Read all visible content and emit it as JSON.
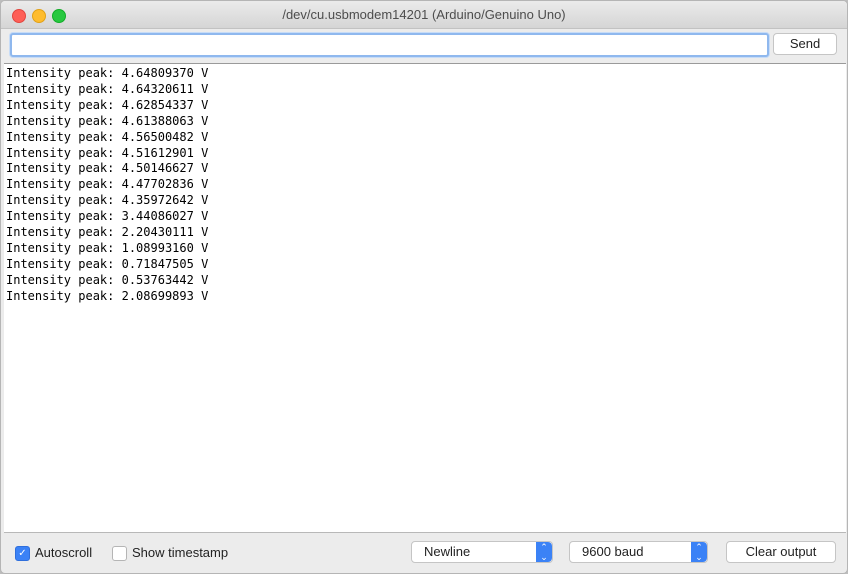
{
  "window": {
    "title": "/dev/cu.usbmodem14201 (Arduino/Genuino Uno)"
  },
  "input": {
    "value": "",
    "placeholder": ""
  },
  "toolbar": {
    "send_label": "Send"
  },
  "output": {
    "lines": [
      "Intensity peak: 4.64809370 V",
      "Intensity peak: 4.64320611 V",
      "Intensity peak: 4.62854337 V",
      "Intensity peak: 4.61388063 V",
      "Intensity peak: 4.56500482 V",
      "Intensity peak: 4.51612901 V",
      "Intensity peak: 4.50146627 V",
      "Intensity peak: 4.47702836 V",
      "Intensity peak: 4.35972642 V",
      "Intensity peak: 3.44086027 V",
      "Intensity peak: 2.20430111 V",
      "Intensity peak: 1.08993160 V",
      "Intensity peak: 0.71847505 V",
      "Intensity peak: 0.53763442 V",
      "Intensity peak: 2.08699893 V"
    ]
  },
  "footer": {
    "autoscroll_label": "Autoscroll",
    "autoscroll_checked": true,
    "timestamp_label": "Show timestamp",
    "timestamp_checked": false,
    "line_ending_selected": "Newline",
    "baud_selected": "9600 baud",
    "clear_label": "Clear output"
  },
  "icons": {
    "check": "✓",
    "updown": "⌃⌄"
  },
  "colors": {
    "accent": "#3b82f6",
    "close": "#fe5f57",
    "minimize": "#febc2e",
    "maximize": "#28c840"
  }
}
